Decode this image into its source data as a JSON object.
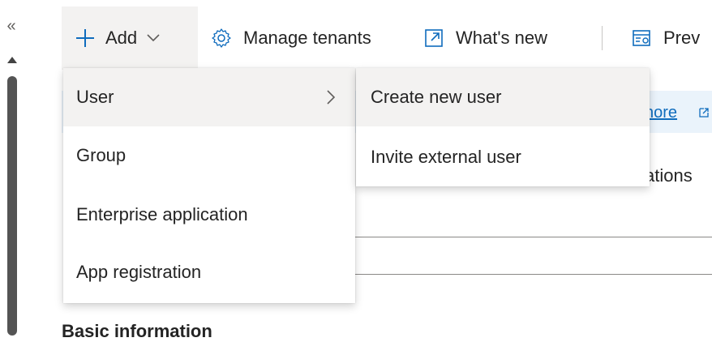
{
  "sidebar": {
    "collapse_glyph": "«"
  },
  "toolbar": {
    "add_label": "Add",
    "manage_tenants_label": "Manage tenants",
    "whats_new_label": "What's new",
    "preview_label": "Prev"
  },
  "background": {
    "learn_more_text": "nore",
    "ations_text": "ations",
    "basic_info_text": "Basic information"
  },
  "add_menu": {
    "items": [
      {
        "label": "User",
        "has_submenu": true
      },
      {
        "label": "Group"
      },
      {
        "label": "Enterprise application"
      },
      {
        "label": "App registration"
      }
    ]
  },
  "user_submenu": {
    "items": [
      {
        "label": "Create new user"
      },
      {
        "label": "Invite external user"
      }
    ]
  },
  "colors": {
    "accent": "#0f6cbd",
    "hover_bg": "#f3f2f1",
    "banner_bg": "#eaf3fb"
  },
  "icons": [
    "collapse-icon",
    "plus-icon",
    "chevron-down-icon",
    "gear-icon",
    "open-external-icon",
    "preview-features-icon",
    "chevron-right-icon"
  ]
}
